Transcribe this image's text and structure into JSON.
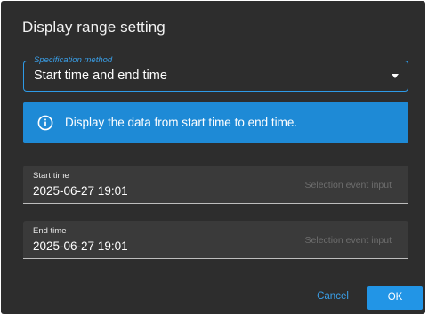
{
  "dialog": {
    "title": "Display range setting"
  },
  "specification": {
    "label": "Specification method",
    "value": "Start time and end time",
    "icon": "chevron-down-icon"
  },
  "info": {
    "icon": "info-icon",
    "text": "Display the data from start time to end time.",
    "color": "#1e8ad6"
  },
  "start_time": {
    "label": "Start time",
    "value": "2025-06-27 19:01",
    "hint": "Selection event input"
  },
  "end_time": {
    "label": "End time",
    "value": "2025-06-27 19:01",
    "hint": "Selection event input"
  },
  "actions": {
    "cancel_label": "Cancel",
    "ok_label": "OK"
  },
  "colors": {
    "background": "#2d2d2d",
    "accent": "#2295e6"
  }
}
